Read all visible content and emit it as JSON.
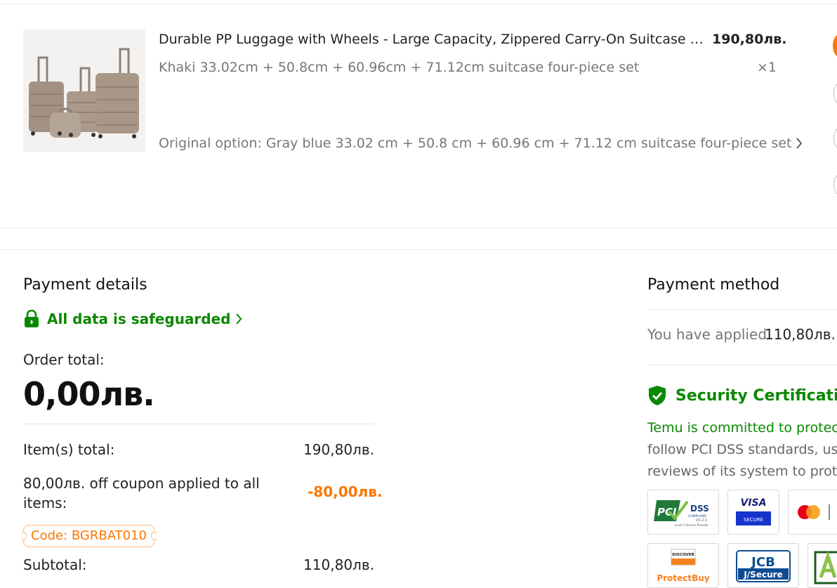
{
  "product": {
    "title": "Durable PP Luggage with Wheels - Large Capacity, Zippered Carry-On Suitcase for Travel",
    "price": "190,80лв.",
    "variant": "Khaki 33.02cm + 50.8cm + 60.96cm + 71.12cm suitcase four-piece set",
    "quantity": "×1",
    "original_option": "Original option: Gray blue 33.02 cm + 50.8 cm + 60.96 cm + 71.12 cm suitcase four-piece set"
  },
  "payment_details": {
    "title": "Payment details",
    "safeguard_label": "All data is safeguarded",
    "order_total_label": "Order total:",
    "order_total_value": "0,00лв.",
    "items_total_label": "Item(s) total:",
    "items_total_value": "190,80лв.",
    "coupon_label": "80,00лв. off coupon applied to all items:",
    "coupon_value": "-80,00лв.",
    "coupon_code": "Code: BGRBAT010",
    "subtotal_label": "Subtotal:",
    "subtotal_value": "110,80лв."
  },
  "payment_method": {
    "title": "Payment method",
    "applied_label": "You have applied",
    "applied_value": "110,80лв.",
    "security_title": "Security Certification",
    "security_line1": "Temu is committed to protect",
    "security_line2": "follow PCI DSS standards, use",
    "security_line3": "reviews of its system to prote",
    "badges": {
      "pci_big": "DSS",
      "pci_small": "COMPLIANT",
      "pci_version": "V3.2.1",
      "pci_sub": "Level 1 Service Provider",
      "visa_top": "VISA",
      "visa_bottom": "SECURE",
      "discover": "DISCOVER",
      "protectbuy": "ProtectBuy",
      "jcb": "JCB",
      "jsecure": "J/Secure"
    }
  },
  "colors": {
    "green": "#0a8800",
    "orange": "#fb7701"
  }
}
